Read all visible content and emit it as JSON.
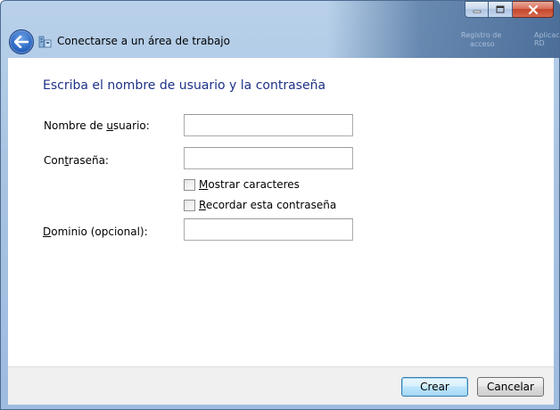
{
  "window": {
    "title": "Conectarse a un área de trabajo",
    "glass_text_1": "Registro de",
    "glass_text_2": "acceso",
    "glass_text_3": "Aplicaciones RD"
  },
  "form": {
    "heading": "Escriba el nombre de usuario y la contraseña",
    "username_label_pre": "Nombre de ",
    "username_label_accel": "u",
    "username_label_post": "suario:",
    "username_value": "",
    "password_label_pre": "Con",
    "password_label_accel": "t",
    "password_label_post": "raseña:",
    "password_value": "",
    "show_chars_accel": "M",
    "show_chars_rest": "ostrar caracteres",
    "show_chars_checked": false,
    "remember_accel": "R",
    "remember_rest": "ecordar esta contraseña",
    "remember_checked": false,
    "domain_label_accel": "D",
    "domain_label_rest": "ominio (opcional):",
    "domain_value": ""
  },
  "footer": {
    "create_label": "Crear",
    "cancel_label": "Cancelar"
  },
  "icons": {
    "back": "back-arrow-icon",
    "app": "workplace-connection-icon",
    "minimize": "minimize-icon",
    "maximize": "maximize-icon",
    "close": "close-icon"
  }
}
